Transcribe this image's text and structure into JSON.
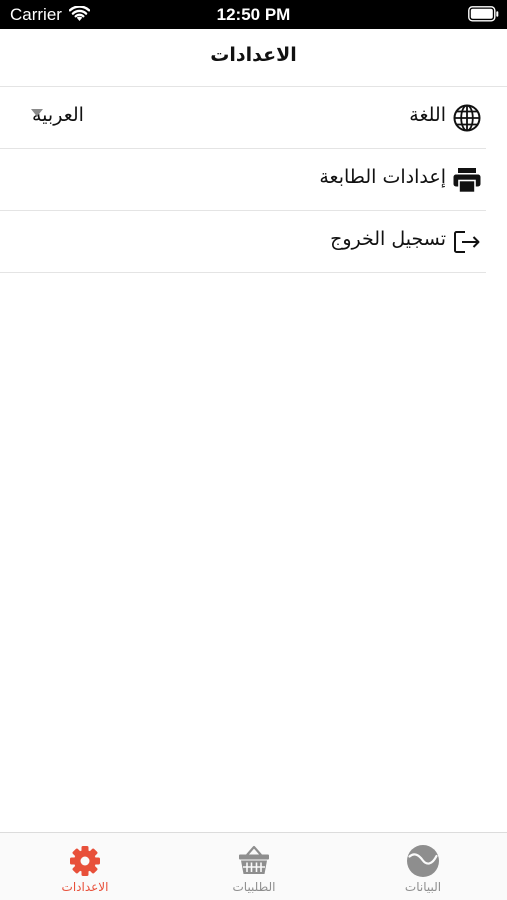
{
  "status_bar": {
    "carrier": "Carrier",
    "time": "12:50 PM",
    "wifi_icon": "wifi-icon",
    "battery_icon": "battery-icon"
  },
  "nav": {
    "title": "الاعدادات"
  },
  "settings": {
    "language": {
      "label": "اللغة",
      "value": "العربية",
      "icon": "globe-icon"
    },
    "printer": {
      "label": "إعدادات الطابعة",
      "icon": "printer-icon"
    },
    "logout": {
      "label": "تسجيل الخروج",
      "icon": "logout-icon"
    }
  },
  "tabs": [
    {
      "label": "الاعدادات",
      "icon": "gear-icon",
      "active": true
    },
    {
      "label": "الطلبيات",
      "icon": "basket-icon",
      "active": false
    },
    {
      "label": "البيانات",
      "icon": "data-icon",
      "active": false
    }
  ],
  "colors": {
    "accent": "#e8503a",
    "inactive": "#8e8e8e",
    "separator": "#e4e4e4"
  }
}
